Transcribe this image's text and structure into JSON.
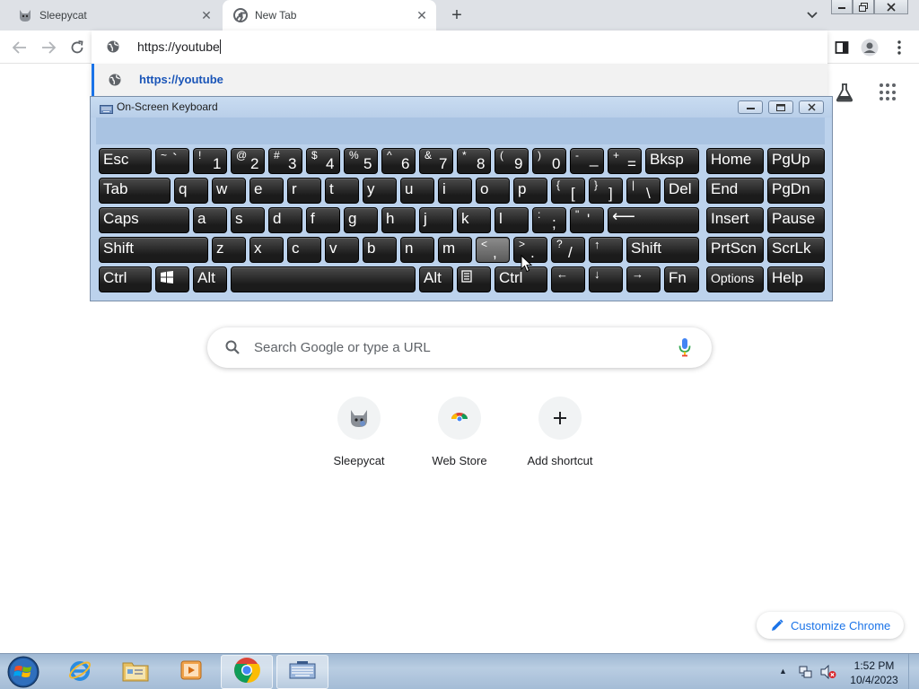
{
  "browser": {
    "tabs": [
      {
        "title": "Sleepycat",
        "active": false
      },
      {
        "title": "New Tab",
        "active": true
      }
    ],
    "omnibox_text": "https://youtube",
    "suggestion_text": "https://youtube"
  },
  "ntp": {
    "search_placeholder": "Search Google or type a URL",
    "shortcuts": [
      {
        "label": "Sleepycat",
        "icon": "cat-icon"
      },
      {
        "label": "Web Store",
        "icon": "web-store-icon"
      },
      {
        "label": "Add shortcut",
        "icon": "plus-icon"
      }
    ],
    "customize_label": "Customize Chrome"
  },
  "osk": {
    "title": "On-Screen Keyboard",
    "keys": {
      "esc": "Esc",
      "tilde_sub": "~",
      "tilde_main": "`",
      "k1_sub": "!",
      "k1": "1",
      "k2_sub": "@",
      "k2": "2",
      "k3_sub": "#",
      "k3": "3",
      "k4_sub": "$",
      "k4": "4",
      "k5_sub": "%",
      "k5": "5",
      "k6_sub": "^",
      "k6": "6",
      "k7_sub": "&",
      "k7": "7",
      "k8_sub": "*",
      "k8": "8",
      "k9_sub": "(",
      "k9": "9",
      "k0_sub": ")",
      "k0": "0",
      "minus_sub": "-",
      "minus": "_",
      "equals_sub": "+",
      "equals": "=",
      "bksp": "Bksp",
      "home": "Home",
      "pgup": "PgUp",
      "tab": "Tab",
      "q": "q",
      "w": "w",
      "e": "e",
      "r": "r",
      "t": "t",
      "y": "y",
      "u": "u",
      "i": "i",
      "o": "o",
      "p": "p",
      "lbracket_sub": "{",
      "lbracket": "[",
      "rbracket_sub": "}",
      "rbracket": "]",
      "backslash_sub": "|",
      "backslash": "\\",
      "del": "Del",
      "end": "End",
      "pgdn": "PgDn",
      "caps": "Caps",
      "a": "a",
      "s": "s",
      "d": "d",
      "f": "f",
      "g": "g",
      "h": "h",
      "j": "j",
      "k": "k",
      "l": "l",
      "semicolon_sub": ":",
      "semicolon": ";",
      "quote_sub": "\"",
      "quote": "'",
      "enter": "⟵",
      "insert": "Insert",
      "pause": "Pause",
      "lshift": "Shift",
      "z": "z",
      "x": "x",
      "c": "c",
      "v": "v",
      "b": "b",
      "n": "n",
      "m": "m",
      "comma_sub": "<",
      "comma": ",",
      "period_sub": ">",
      "period": ".",
      "slash_sub": "?",
      "slash": "/",
      "up": "↑",
      "rshift": "Shift",
      "prtscn": "PrtScn",
      "scrlk": "ScrLk",
      "lctrl": "Ctrl",
      "lalt": "Alt",
      "ralt": "Alt",
      "rctrl": "Ctrl",
      "left": "←",
      "down": "↓",
      "right": "→",
      "fn": "Fn",
      "options": "Options",
      "help": "Help"
    }
  },
  "taskbar": {
    "time": "1:52 PM",
    "date": "10/4/2023"
  }
}
